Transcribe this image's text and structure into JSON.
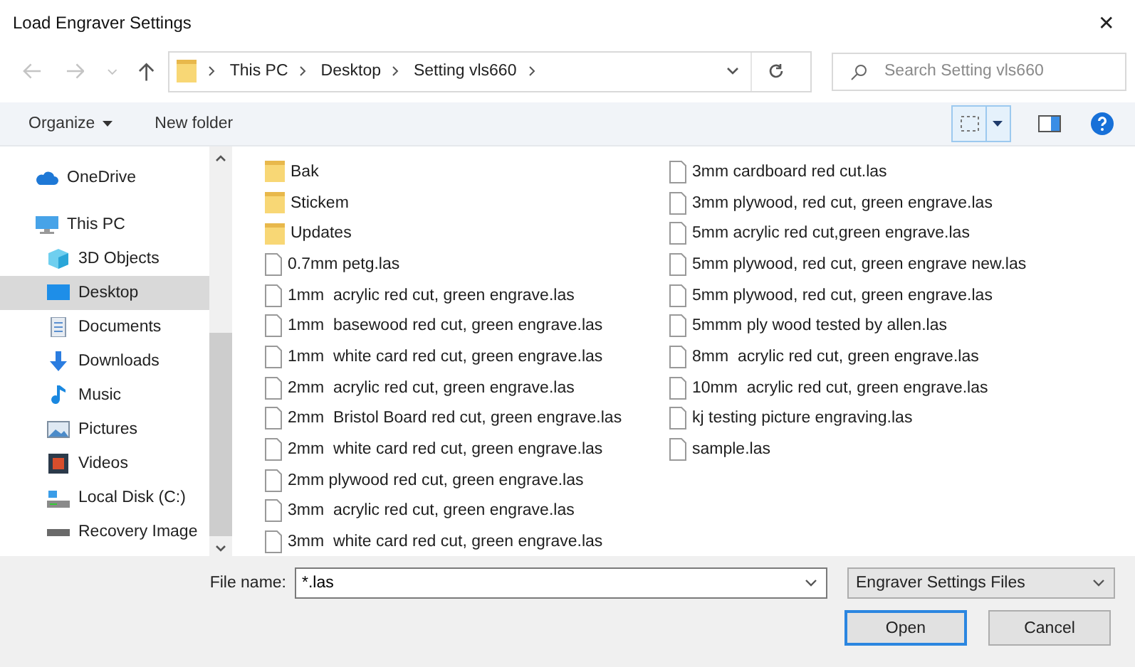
{
  "window": {
    "title": "Load Engraver Settings",
    "close": "✕"
  },
  "address": {
    "crumbs": [
      "This PC",
      "Desktop",
      "Setting vls660"
    ]
  },
  "search": {
    "placeholder": "Search Setting vls660"
  },
  "toolbar": {
    "organize": "Organize",
    "new_folder": "New folder"
  },
  "sidebar": {
    "items": [
      {
        "label": "OneDrive",
        "kind": "cloud",
        "selected": false
      },
      {
        "label": "This PC",
        "kind": "pc",
        "selected": false,
        "children": [
          {
            "label": "3D Objects",
            "kind": "objects",
            "selected": false
          },
          {
            "label": "Desktop",
            "kind": "desktop",
            "selected": true
          },
          {
            "label": "Documents",
            "kind": "documents",
            "selected": false
          },
          {
            "label": "Downloads",
            "kind": "downloads",
            "selected": false
          },
          {
            "label": "Music",
            "kind": "music",
            "selected": false
          },
          {
            "label": "Pictures",
            "kind": "pictures",
            "selected": false
          },
          {
            "label": "Videos",
            "kind": "videos",
            "selected": false
          },
          {
            "label": "Local Disk (C:)",
            "kind": "disk",
            "selected": false
          },
          {
            "label": "Recovery Image",
            "kind": "drive",
            "selected": false
          }
        ]
      }
    ]
  },
  "files": [
    {
      "name": "Bak",
      "kind": "folder"
    },
    {
      "name": "Stickem",
      "kind": "folder"
    },
    {
      "name": "Updates",
      "kind": "folder"
    },
    {
      "name": "0.7mm petg.las",
      "kind": "file"
    },
    {
      "name": "1mm  acrylic red cut, green engrave.las",
      "kind": "file"
    },
    {
      "name": "1mm  basewood red cut, green engrave.las",
      "kind": "file"
    },
    {
      "name": "1mm  white card red cut, green engrave.las",
      "kind": "file"
    },
    {
      "name": "2mm  acrylic red cut, green engrave.las",
      "kind": "file"
    },
    {
      "name": "2mm  Bristol Board red cut, green engrave.las",
      "kind": "file"
    },
    {
      "name": "2mm  white card red cut, green engrave.las",
      "kind": "file"
    },
    {
      "name": "2mm plywood red cut, green engrave.las",
      "kind": "file"
    },
    {
      "name": "3mm  acrylic red cut, green engrave.las",
      "kind": "file"
    },
    {
      "name": "3mm  white card red cut, green engrave.las",
      "kind": "file"
    },
    {
      "name": "3mm cardboard red cut.las",
      "kind": "file"
    },
    {
      "name": "3mm plywood, red cut, green engrave.las",
      "kind": "file"
    },
    {
      "name": "5mm acrylic red cut,green engrave.las",
      "kind": "file"
    },
    {
      "name": "5mm plywood, red cut, green engrave new.las",
      "kind": "file"
    },
    {
      "name": "5mm plywood, red cut, green engrave.las",
      "kind": "file"
    },
    {
      "name": "5mmm ply wood tested by allen.las",
      "kind": "file"
    },
    {
      "name": "8mm  acrylic red cut, green engrave.las",
      "kind": "file"
    },
    {
      "name": "10mm  acrylic red cut, green engrave.las",
      "kind": "file"
    },
    {
      "name": "kj testing picture engraving.las",
      "kind": "file"
    },
    {
      "name": "sample.las",
      "kind": "file"
    }
  ],
  "footer": {
    "file_name_label": "File name:",
    "file_name_value": "*.las",
    "file_type": "Engraver Settings Files",
    "buttons": [
      {
        "label": "Open",
        "selected": true
      },
      {
        "label": "Cancel",
        "selected": false
      }
    ]
  }
}
